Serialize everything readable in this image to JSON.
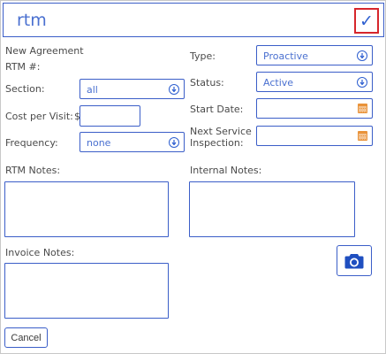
{
  "header": {
    "title": "rtm",
    "confirm_icon": "✓"
  },
  "form": {
    "heading": "New Agreement",
    "rtm_label": "RTM #:",
    "section": {
      "label": "Section:",
      "value": "all"
    },
    "cost_per_visit": {
      "label": "Cost per Visit:",
      "currency": "$",
      "value": ""
    },
    "frequency": {
      "label": "Frequency:",
      "value": "none"
    },
    "type": {
      "label": "Type:",
      "value": "Proactive"
    },
    "status": {
      "label": "Status:",
      "value": "Active"
    },
    "start_date": {
      "label": "Start Date:",
      "value": ""
    },
    "next_service": {
      "label": "Next Service Inspection:",
      "value": ""
    },
    "rtm_notes": {
      "label": "RTM Notes:",
      "value": ""
    },
    "internal_notes": {
      "label": "Internal Notes:",
      "value": ""
    },
    "invoice_notes": {
      "label": "Invoice Notes:",
      "value": ""
    }
  },
  "actions": {
    "cancel_label": "Cancel"
  },
  "colors": {
    "accent": "#3b5ec8",
    "confirm_border": "#d6262c",
    "calendar": "#e9933a"
  }
}
